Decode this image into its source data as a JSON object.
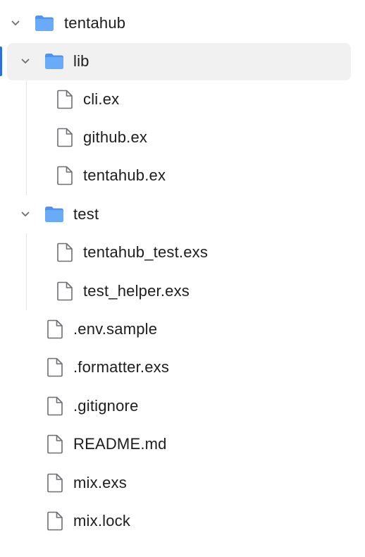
{
  "root": {
    "label": "tentahub",
    "expanded": true
  },
  "lib": {
    "label": "lib",
    "expanded": true,
    "selected": true,
    "files": [
      "cli.ex",
      "github.ex",
      "tentahub.ex"
    ]
  },
  "test": {
    "label": "test",
    "expanded": true,
    "files": [
      "tentahub_test.exs",
      "test_helper.exs"
    ]
  },
  "root_files": [
    ".env.sample",
    ".formatter.exs",
    ".gitignore",
    "README.md",
    "mix.exs",
    "mix.lock"
  ],
  "colors": {
    "folder": "#5aa1f5",
    "selection": "#f1f1f2",
    "focus": "#2f6fdc",
    "text": "#1d1d1f"
  }
}
